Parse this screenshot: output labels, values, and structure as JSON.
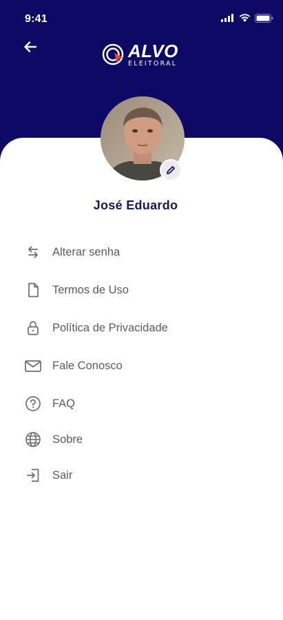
{
  "status_bar": {
    "time": "9:41"
  },
  "header": {
    "back_icon": "arrow-left-icon",
    "logo": {
      "main": "ALVO",
      "sub": "ELEITORAL"
    },
    "background_color": "#0c0a66",
    "accent_color": "#e8472b"
  },
  "profile": {
    "name": "José Eduardo",
    "avatar_icon": "user-photo",
    "edit_icon": "pencil-icon"
  },
  "menu": {
    "items": [
      {
        "label": "Alterar senha",
        "icon": "swap-arrows-icon"
      },
      {
        "label": "Termos de Uso",
        "icon": "document-icon"
      },
      {
        "label": "Política de Privacidade",
        "icon": "lock-icon"
      },
      {
        "label": "Fale Conosco",
        "icon": "mail-icon"
      },
      {
        "label": "FAQ",
        "icon": "question-circle-icon"
      },
      {
        "label": "Sobre",
        "icon": "globe-icon"
      },
      {
        "label": "Sair",
        "icon": "logout-icon"
      }
    ]
  }
}
